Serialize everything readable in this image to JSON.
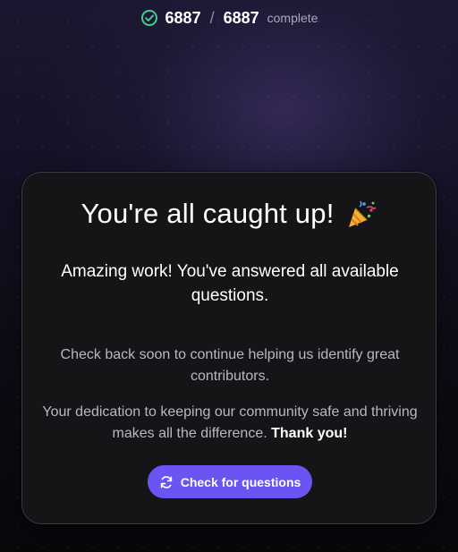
{
  "progress": {
    "completed": "6887",
    "separator": "/",
    "total": "6887",
    "label": "complete",
    "icon": "check-circle-icon",
    "icon_color": "#3ecf8e"
  },
  "card": {
    "title": "You're all caught up!",
    "title_icon": "party-popper-icon",
    "subtitle": "Amazing work! You've answered all available questions.",
    "note1": "Check back soon to continue helping us identify great contributors.",
    "note2_text": "Your dedication to keeping our community safe and thriving makes all the difference.",
    "note2_emphasis": "Thank you!",
    "button_label": "Check for questions",
    "button_icon": "refresh-icon",
    "accent_color": "#6b55f2"
  }
}
